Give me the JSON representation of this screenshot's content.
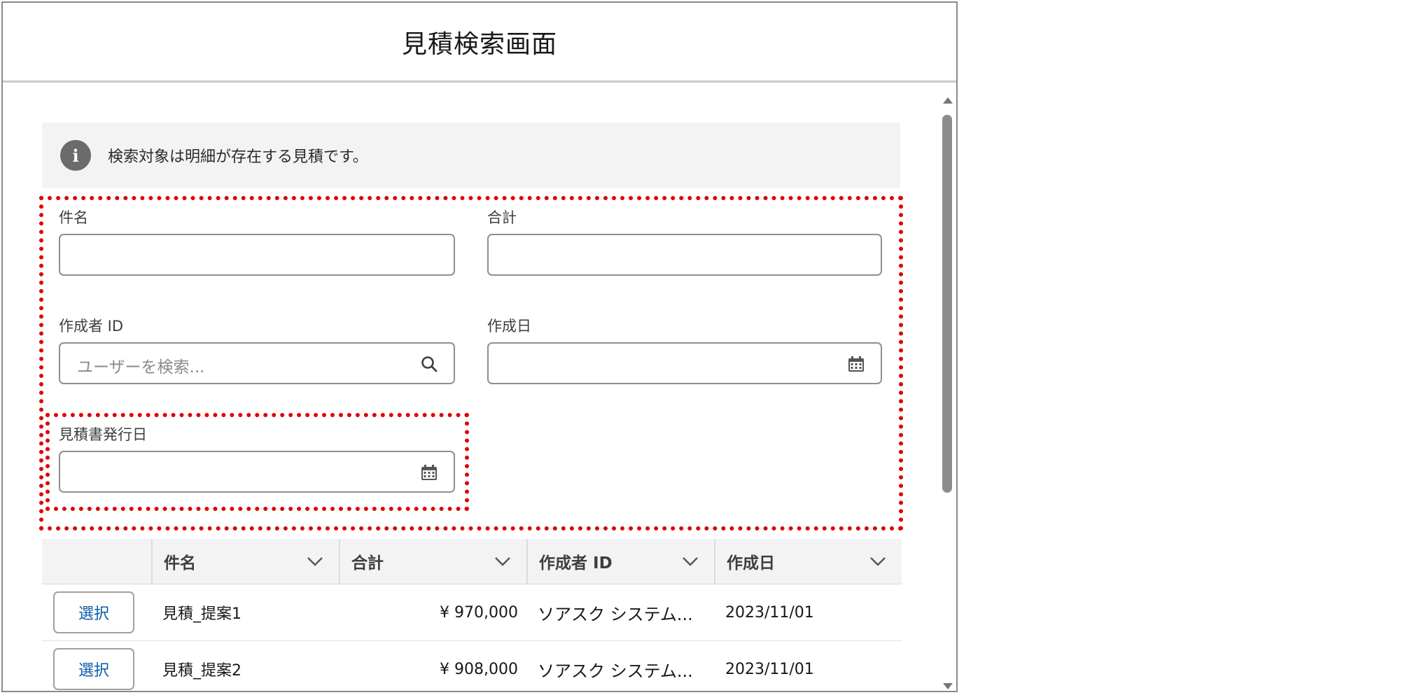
{
  "modal": {
    "title": "見積検索画面"
  },
  "info": {
    "message": "検索対象は明細が存在する見積です。"
  },
  "form": {
    "subject": {
      "label": "件名",
      "value": ""
    },
    "total": {
      "label": "合計",
      "value": ""
    },
    "creator": {
      "label": "作成者 ID",
      "placeholder": "ユーザーを検索..."
    },
    "created_date": {
      "label": "作成日",
      "value": ""
    },
    "quote_issue_date": {
      "label": "見積書発行日",
      "value": ""
    }
  },
  "table": {
    "columns": [
      "件名",
      "合計",
      "作成者 ID",
      "作成日"
    ],
    "rows": [
      {
        "action": "選択",
        "subject": "見積_提案1",
        "total": "¥ 970,000",
        "creator": "ソアスク システム...",
        "date": "2023/11/01"
      },
      {
        "action": "選択",
        "subject": "見積_提案2",
        "total": "¥ 908,000",
        "creator": "ソアスク システム...",
        "date": "2023/11/01"
      }
    ]
  },
  "colors": {
    "highlight": "#e00000",
    "link": "#0b5cab"
  }
}
